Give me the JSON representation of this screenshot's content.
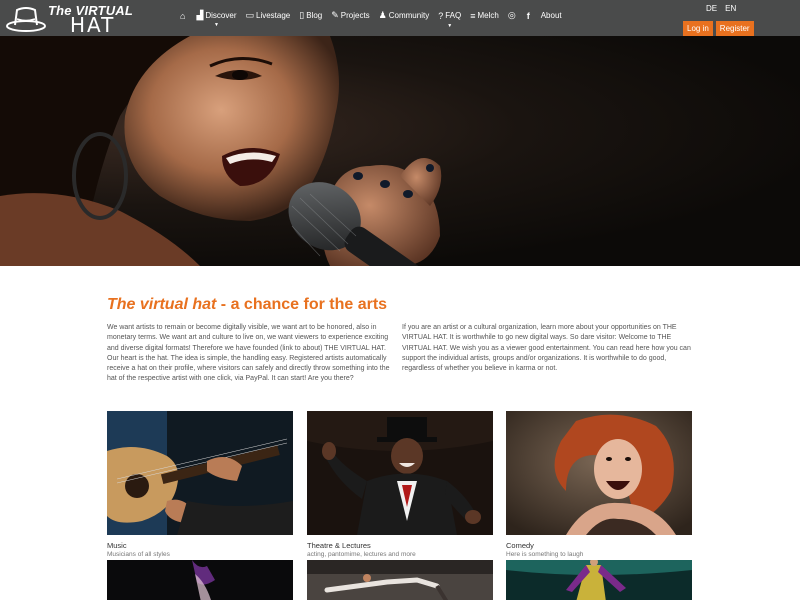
{
  "brand": {
    "line1": "The VIRTUAL",
    "line2": "HAT"
  },
  "nav": [
    {
      "icon": "home-icon",
      "glyph": "⌂",
      "label": ""
    },
    {
      "icon": "building-icon",
      "glyph": "▟",
      "label": "Discover",
      "caret": true
    },
    {
      "icon": "tv-icon",
      "glyph": "▭",
      "label": "Livestage"
    },
    {
      "icon": "file-icon",
      "glyph": "▯",
      "label": "Blog"
    },
    {
      "icon": "edit-icon",
      "glyph": "✎",
      "label": "Projects"
    },
    {
      "icon": "users-icon",
      "glyph": "♟",
      "label": "Community"
    },
    {
      "icon": "question-icon",
      "glyph": "?",
      "label": "FAQ",
      "caret": true
    },
    {
      "icon": "list-icon",
      "glyph": "≡",
      "label": "Melch"
    },
    {
      "icon": "instagram-icon",
      "glyph": "◎",
      "label": ""
    },
    {
      "icon": "facebook-icon",
      "glyph": "f",
      "label": ""
    },
    {
      "icon": "",
      "glyph": "",
      "label": "About"
    }
  ],
  "lang": [
    "DE",
    "EN"
  ],
  "auth": {
    "login": "Log in",
    "register": "Register"
  },
  "intro": {
    "title_italic": "The virtual hat",
    "title_rest": " - a chance for the arts",
    "col1": "We want artists to remain or become digitally visible, we want art to be honored, also in monetary terms. We want art and culture to live on, we want viewers to experience exciting and diverse digital formats! Therefore we have founded (link to about) THE VIRTUAL HAT. Our heart is the hat. The idea is simple, the handling easy. Registered artists automatically receive a hat on their profile, where visitors can safely and directly throw something into the hat of the respective artist with one click, via PayPal. It can start! Are you there?",
    "col2": "If you are an artist or a cultural organization, learn more about your opportunities on THE VIRTUAL HAT. It is worthwhile to go new digital ways. So dare visitor: Welcome to THE VIRTUAL HAT. We wish you as a viewer good entertainment. You can read here how you can support the individual artists, groups and/or organizations. It is worthwhile to do good, regardless of whether you believe in karma or not."
  },
  "categories": [
    {
      "title": "Music",
      "subtitle": "Musicians of all styles"
    },
    {
      "title": "Theatre & Lectures",
      "subtitle": "acting, pantomime, lectures and more"
    },
    {
      "title": "Comedy",
      "subtitle": "Here is something to laugh"
    }
  ],
  "colors": {
    "nav_bg": "#4a4b4b",
    "accent": "#e8711f"
  }
}
